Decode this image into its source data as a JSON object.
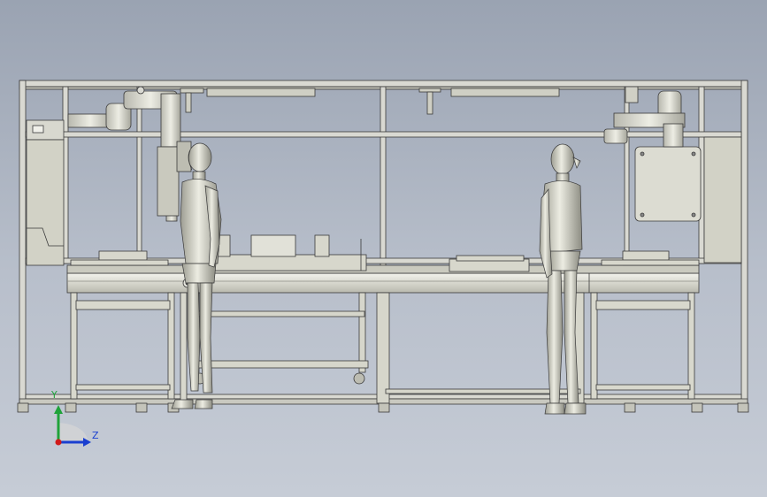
{
  "view": {
    "background_top": "#9aa3b2",
    "background_bottom": "#c6ccd6",
    "frame_color": "#d9d9d2",
    "frame_edge": "#3a3a3a",
    "panel_color": "#d4d4c8"
  },
  "triad": {
    "y_label": "Y",
    "z_label": "Z",
    "y_color": "#1fa33a",
    "z_color": "#1a3fd0",
    "origin_color": "#d01a1a"
  }
}
